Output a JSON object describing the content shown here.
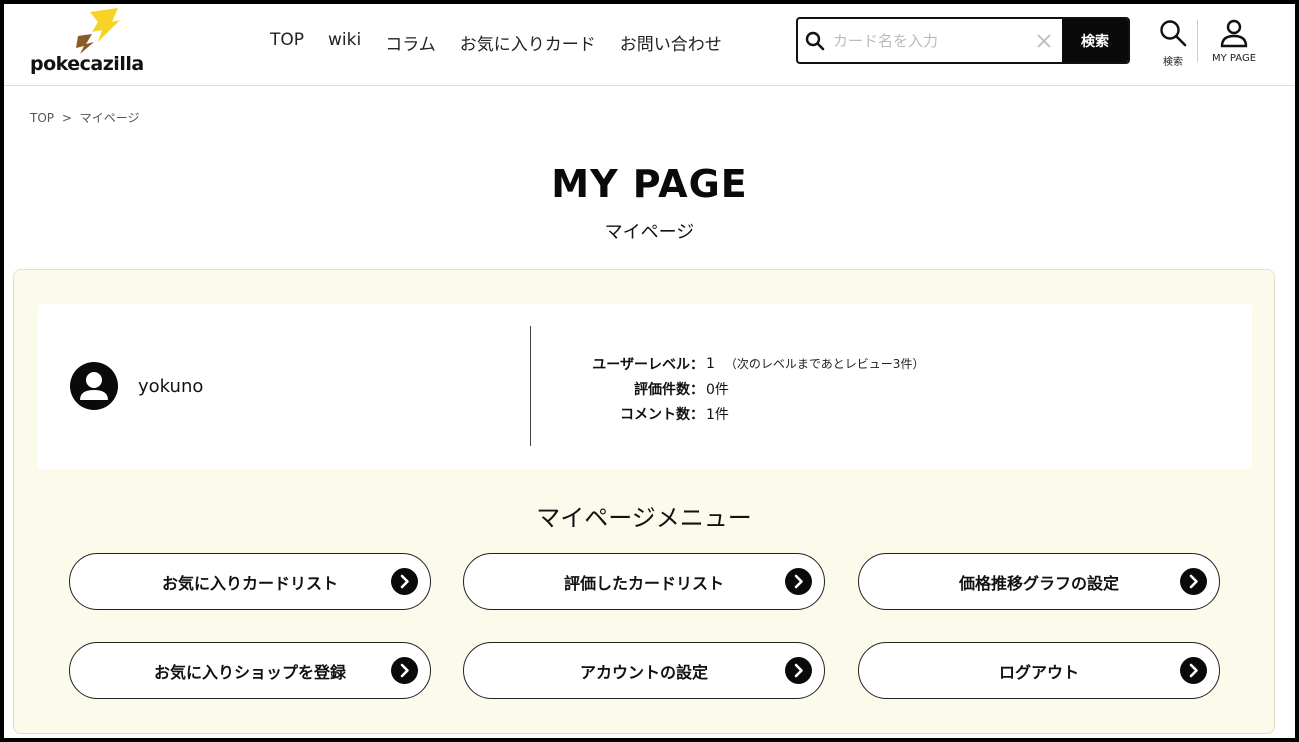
{
  "header": {
    "logo_text": "pokecazilla",
    "nav": [
      "TOP",
      "wiki",
      "コラム",
      "お気に入りカード",
      "お問い合わせ"
    ],
    "search": {
      "placeholder": "カード名を入力",
      "button_label": "検索"
    },
    "search_icon_label": "検索",
    "mypage_icon_label": "MY PAGE"
  },
  "breadcrumb": {
    "home": "TOP",
    "separator": ">",
    "current": "マイページ"
  },
  "page": {
    "title": "MY PAGE",
    "subtitle": "マイページ"
  },
  "profile": {
    "username": "yokuno",
    "stats": [
      {
        "label": "ユーザーレベル",
        "value": "1",
        "note": "（次のレベルまであとレビュー3件）"
      },
      {
        "label": "評価件数",
        "value": "0件",
        "note": ""
      },
      {
        "label": "コメント数",
        "value": "1件",
        "note": ""
      }
    ]
  },
  "menu": {
    "title": "マイページメニュー",
    "items": [
      {
        "label": "お気に入りカードリスト"
      },
      {
        "label": "評価したカードリスト"
      },
      {
        "label": "価格推移グラフの設定"
      },
      {
        "label": "お気に入りショップを登録"
      },
      {
        "label": "アカウントの設定"
      },
      {
        "label": "ログアウト"
      }
    ]
  },
  "colors": {
    "panel_bg": "#fcfbeb",
    "logo_yellow": "#f7d325",
    "logo_brown": "#8a5a2a",
    "button_dark": "#0a0a0a"
  }
}
